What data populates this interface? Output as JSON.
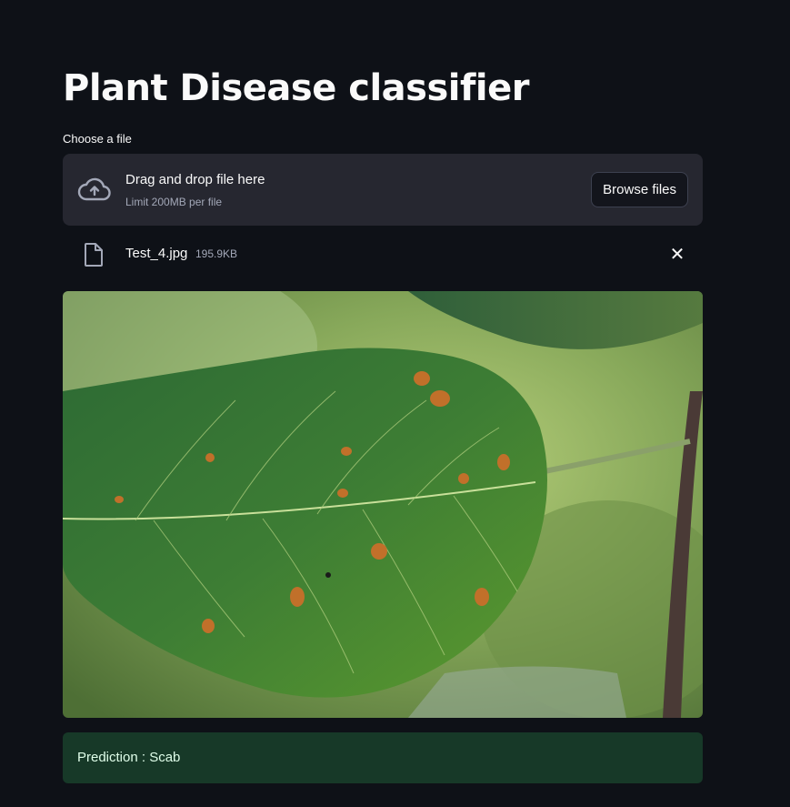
{
  "app": {
    "title": "Plant Disease classifier"
  },
  "uploader": {
    "label": "Choose a file",
    "drop_text": "Drag and drop file here",
    "limit_text": "Limit 200MB per file",
    "browse_label": "Browse files"
  },
  "uploaded_file": {
    "name": "Test_4.jpg",
    "size": "195.9KB"
  },
  "result": {
    "text": "Prediction : Scab",
    "color": "#173928"
  },
  "colors": {
    "background": "#0e1117",
    "dropzone": "#262730",
    "text": "#fafafa",
    "muted": "#a3a8b8"
  },
  "icons": {
    "upload": "cloud-upload-icon",
    "file": "file-icon",
    "remove": "close-icon"
  }
}
